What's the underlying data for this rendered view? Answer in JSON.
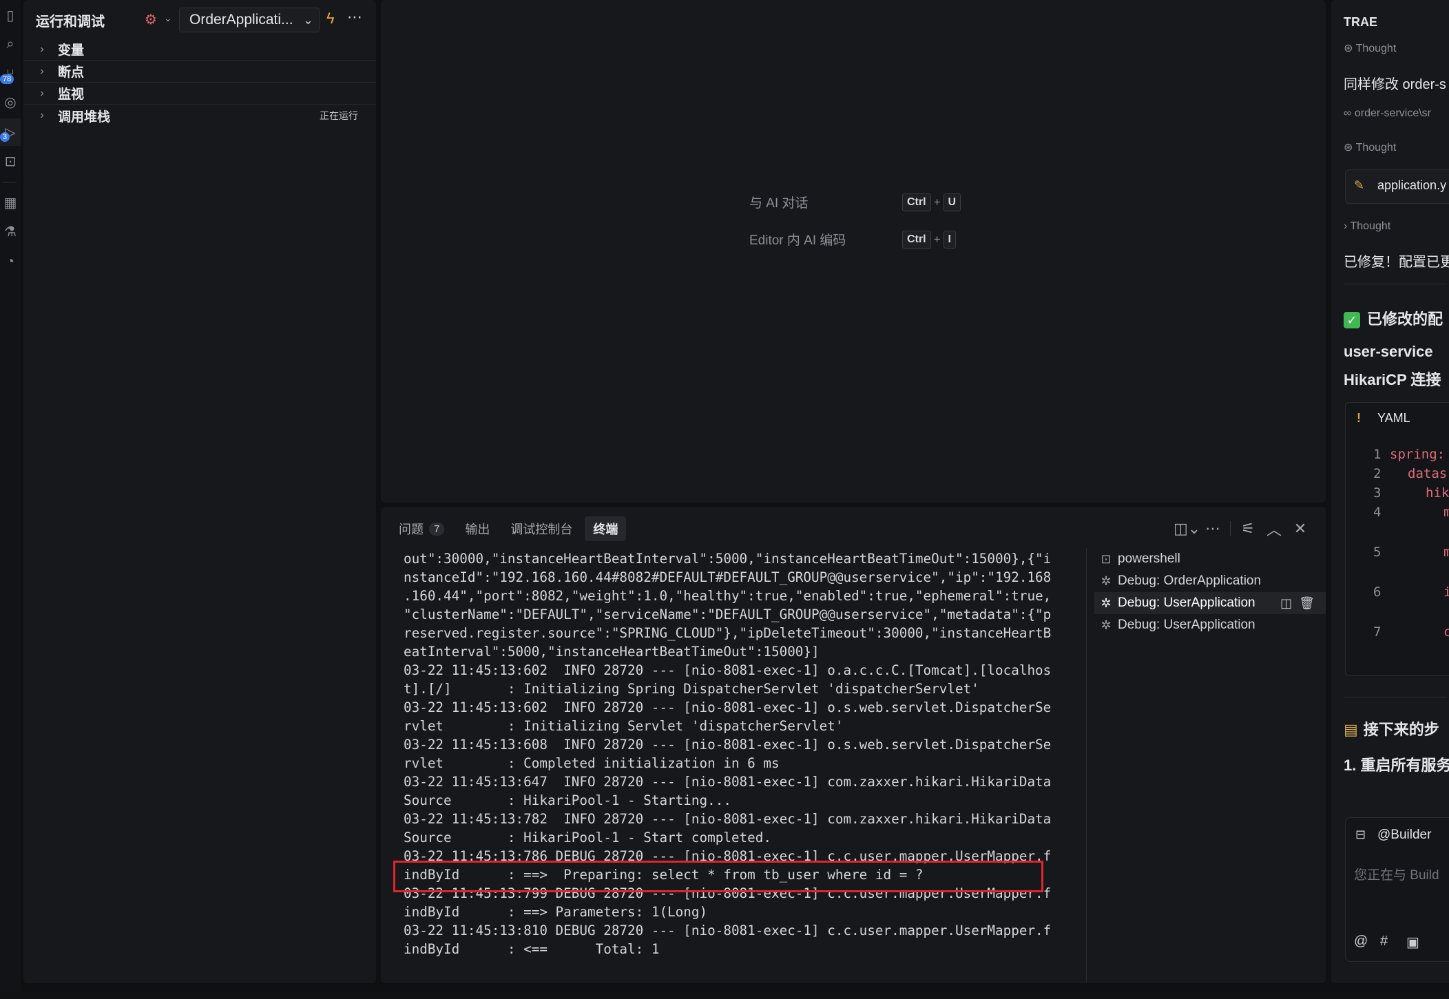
{
  "activity": {
    "badges": [
      "78",
      "3"
    ],
    "icons": [
      "files-icon",
      "search-icon",
      "source-control-icon",
      "remote-icon",
      "run-debug-icon",
      "testing-icon",
      "extensions-icon",
      "beaker-icon",
      "accounts-icon"
    ]
  },
  "sidebar": {
    "title": "运行和调试",
    "config": "OrderApplicati...",
    "sections": [
      {
        "label": "变量",
        "status": ""
      },
      {
        "label": "断点",
        "status": ""
      },
      {
        "label": "监视",
        "status": ""
      },
      {
        "label": "调用堆栈",
        "status": "正在运行"
      }
    ]
  },
  "editor": {
    "hints": [
      {
        "label": "与 AI 对话",
        "key1": "Ctrl",
        "plus": "+",
        "key2": "U"
      },
      {
        "label": "Editor 内 AI 编码",
        "key1": "Ctrl",
        "plus": "+",
        "key2": "I"
      }
    ]
  },
  "panel": {
    "tabs": [
      {
        "label": "问题",
        "badge": "7"
      },
      {
        "label": "输出",
        "badge": ""
      },
      {
        "label": "调试控制台",
        "badge": ""
      },
      {
        "label": "终端",
        "badge": ""
      }
    ],
    "active_tab": "终端",
    "terminal_lines": [
      "out\":30000,\"instanceHeartBeatInterval\":5000,\"instanceHeartBeatTimeOut\":15000},{\"i",
      "nstanceId\":\"192.168.160.44#8082#DEFAULT#DEFAULT_GROUP@@userservice\",\"ip\":\"192.168",
      ".160.44\",\"port\":8082,\"weight\":1.0,\"healthy\":true,\"enabled\":true,\"ephemeral\":true,",
      "\"clusterName\":\"DEFAULT\",\"serviceName\":\"DEFAULT_GROUP@@userservice\",\"metadata\":{\"p",
      "reserved.register.source\":\"SPRING_CLOUD\"},\"ipDeleteTimeout\":30000,\"instanceHeartB",
      "eatInterval\":5000,\"instanceHeartBeatTimeOut\":15000}]",
      "03-22 11:45:13:602  INFO 28720 --- [nio-8081-exec-1] o.a.c.c.C.[Tomcat].[localhos",
      "t].[/]       : Initializing Spring DispatcherServlet 'dispatcherServlet'",
      "03-22 11:45:13:602  INFO 28720 --- [nio-8081-exec-1] o.s.web.servlet.DispatcherSe",
      "rvlet        : Initializing Servlet 'dispatcherServlet'",
      "03-22 11:45:13:608  INFO 28720 --- [nio-8081-exec-1] o.s.web.servlet.DispatcherSe",
      "rvlet        : Completed initialization in 6 ms",
      "03-22 11:45:13:647  INFO 28720 --- [nio-8081-exec-1] com.zaxxer.hikari.HikariData",
      "Source       : HikariPool-1 - Starting...",
      "03-22 11:45:13:782  INFO 28720 --- [nio-8081-exec-1] com.zaxxer.hikari.HikariData",
      "Source       : HikariPool-1 - Start completed.",
      "03-22 11:45:13:786 DEBUG 28720 --- [nio-8081-exec-1] c.c.user.mapper.UserMapper.f",
      "indById      : ==>  Preparing: select * from tb_user where id = ?",
      "03-22 11:45:13:799 DEBUG 28720 --- [nio-8081-exec-1] c.c.user.mapper.UserMapper.f",
      "indById      : ==> Parameters: 1(Long)",
      "03-22 11:45:13:810 DEBUG 28720 --- [nio-8081-exec-1] c.c.user.mapper.UserMapper.f",
      "indById      : <==      Total: 1"
    ],
    "terminals": [
      {
        "label": "powershell",
        "selected": false
      },
      {
        "label": "Debug: OrderApplication",
        "selected": false
      },
      {
        "label": "Debug: UserApplication",
        "selected": true
      },
      {
        "label": "Debug: UserApplication",
        "selected": false
      }
    ]
  },
  "chat": {
    "title": "TRAE",
    "thought1": "Thought",
    "msg1": "同样修改 order-s",
    "file_ref": "order-service\\sr",
    "thought2": "Thought",
    "file_edit": "application.y",
    "thought3": "Thought",
    "msg2": "已修复！配置已更",
    "heading1": "已修改的配",
    "heading2_line1": "user-service",
    "heading2_line2": "HikariCP 连接",
    "code_lang": "YAML",
    "code_lines": [
      "1",
      "2",
      "3",
      "4",
      "5",
      "6",
      "7"
    ],
    "code_tokens": [
      "spring:",
      "datas",
      "hik",
      "m",
      "m",
      "i",
      "c"
    ],
    "heading3": "接下来的步",
    "heading4": "1. 重启所有服务",
    "builder": "@Builder",
    "input_placeholder": "您正在与 Build",
    "accent": "#3fb950"
  }
}
